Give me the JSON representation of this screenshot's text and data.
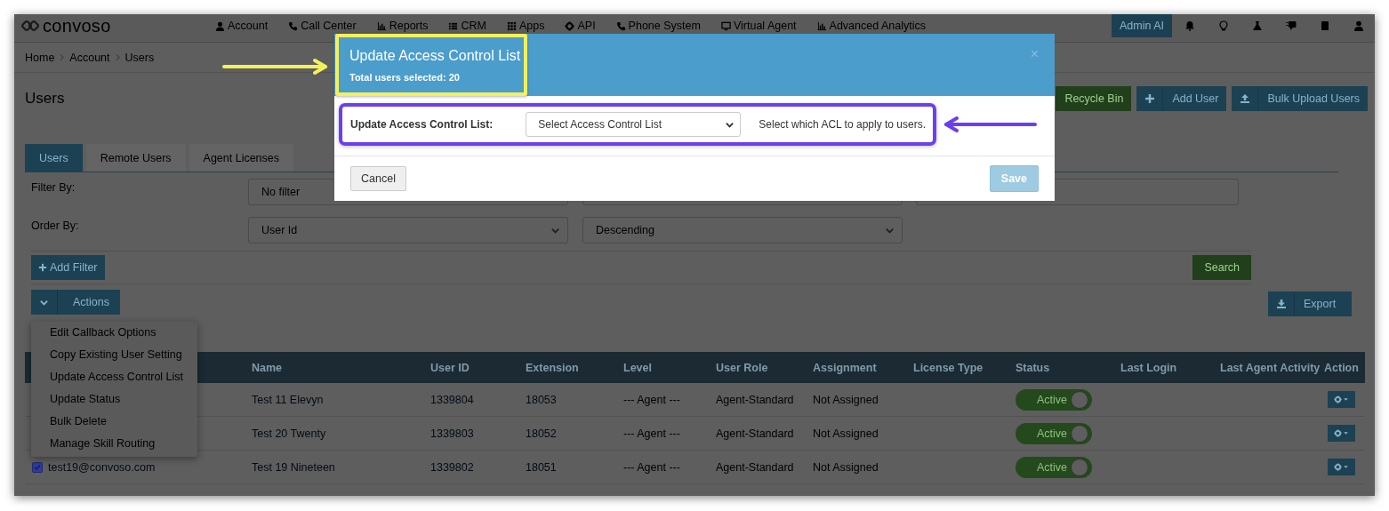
{
  "nav": {
    "logo": "convoso",
    "items": [
      "Account",
      "Call Center",
      "Reports",
      "CRM",
      "Apps",
      "API",
      "Phone System",
      "Virtual Agent",
      "Advanced Analytics"
    ],
    "admin_button": "Admin AI"
  },
  "breadcrumb": [
    "Home",
    "Account",
    "Users"
  ],
  "page": {
    "title": "Users",
    "buttons": [
      {
        "label": "Recycle Bin",
        "kind": "success"
      },
      {
        "label": "Add User",
        "kind": "primary"
      },
      {
        "label": "Bulk Upload Users",
        "kind": "primary"
      }
    ]
  },
  "tabs": [
    {
      "label": "Users",
      "selected": true
    },
    {
      "label": "Remote Users",
      "selected": false
    },
    {
      "label": "Agent Licenses",
      "selected": false
    }
  ],
  "filters": {
    "filter_by_label": "Filter By:",
    "filter_value": "No filter",
    "order_by_label": "Order By:",
    "order_field": "User Id",
    "order_direction": "Descending",
    "add_filter": "Add Filter",
    "search": "Search"
  },
  "actions": {
    "label": "Actions",
    "export": "Export",
    "menu": [
      "Edit Callback Options",
      "Copy Existing User Setting",
      "Update Access Control List",
      "Update Status",
      "Bulk Delete",
      "Manage Skill Routing"
    ]
  },
  "table": {
    "columns": [
      "Name",
      "User ID",
      "Extension",
      "Level",
      "User Role",
      "Assignment",
      "License Type",
      "Status",
      "Last Login",
      "Last Agent Activity",
      "Action"
    ],
    "rows": [
      {
        "name": "Test 11 Elevyn",
        "user_id": "1339804",
        "extension": "18053",
        "level": "--- Agent ---",
        "role": "Agent-Standard",
        "assignment": "Not Assigned",
        "status": "Active",
        "active": true
      },
      {
        "name": "Test 20 Twenty",
        "user_id": "1339803",
        "extension": "18052",
        "level": "--- Agent ---",
        "role": "Agent-Standard",
        "assignment": "Not Assigned",
        "status": "Active",
        "active": true
      },
      {
        "email": "test19@convoso.com",
        "checked": true,
        "name": "Test 19 Nineteen",
        "user_id": "1339802",
        "extension": "18051",
        "level": "--- Agent ---",
        "role": "Agent-Standard",
        "assignment": "Not Assigned",
        "status": "Active",
        "active": true
      }
    ]
  },
  "modal": {
    "title": "Update Access Control List",
    "subtitle": "Total users selected: 20",
    "close": "×",
    "field_label": "Update Access Control List:",
    "select_value": "Select Access Control List",
    "help": "Select which ACL to apply to users.",
    "cancel": "Cancel",
    "save": {
      "label": "Save",
      "disabled": true
    }
  }
}
